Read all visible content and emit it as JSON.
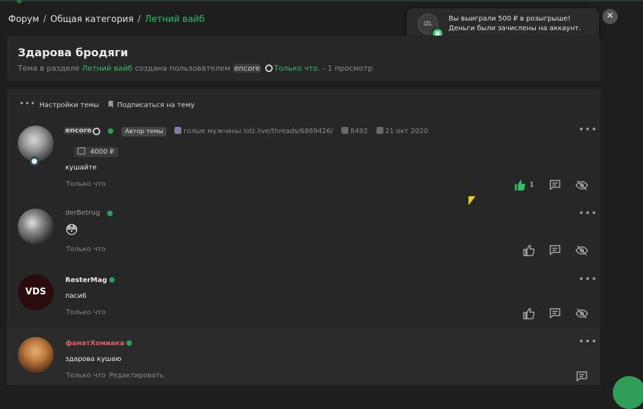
{
  "breadcrumb": {
    "items": [
      "Форум",
      "Общая категория"
    ],
    "active": "Летний вайб",
    "separator": "/"
  },
  "notification": {
    "avatar_text": "lZL",
    "line1": "Вы выиграли 500 ₽ в розыгрыше!",
    "line2": "Деньги были зачислены на аккаунт."
  },
  "thread": {
    "title": "Здарова бродяги",
    "meta_prefix": "Тема в разделе",
    "section": "Летний вайб",
    "meta_created": "создана пользователем",
    "author": "encore",
    "when": "Только что.",
    "views": "- 1 просмотр"
  },
  "options": {
    "settings": "Настройки темы",
    "subscribe": "Подписаться на тему"
  },
  "posts": [
    {
      "nick": "encore",
      "author_badge": "Автор темы",
      "status": "голые мужчины lolz.live/threads/6869426/",
      "likes_total": "8492",
      "reg_date": "21 окт 2020",
      "balance": "4000 ₽",
      "message": "кушайте",
      "time": "Только что",
      "like_count": "1"
    },
    {
      "nick": "derBetrug",
      "message": "😳",
      "time": "Только что"
    },
    {
      "nick": "ResterMag",
      "avatar_text": "VDS",
      "message": "паси6",
      "time": "Только что"
    },
    {
      "nick": "фанатХомиака",
      "message": "здарова кушаю",
      "time": "Только что",
      "edit": "Редактировать"
    }
  ],
  "colors": {
    "accent": "#2fbf6b",
    "background": "#1e1e1e",
    "panel": "#272727",
    "online": "#2f9e58",
    "nick_pink": "#e25d6a"
  },
  "icons": [
    "dots-icon",
    "bookmark-icon",
    "like-icon",
    "comment-icon",
    "hide-icon",
    "close-icon",
    "gift-icon",
    "shield-icon"
  ]
}
